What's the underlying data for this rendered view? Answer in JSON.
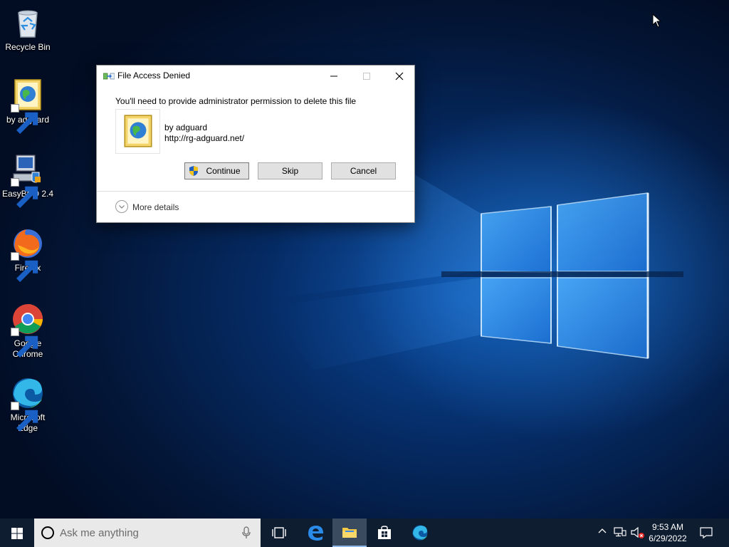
{
  "desktop": {
    "icons": [
      {
        "label": "Recycle Bin",
        "icon": "recycle-bin-icon"
      },
      {
        "label": "by adguard",
        "icon": "adguard-file-icon"
      },
      {
        "label": "EasyBCD 2.4",
        "icon": "easybcd-icon"
      },
      {
        "label": "Firefox",
        "icon": "firefox-icon"
      },
      {
        "label": "Google Chrome",
        "icon": "chrome-icon"
      },
      {
        "label": "Microsoft Edge",
        "icon": "edge-icon"
      }
    ]
  },
  "dialog": {
    "title": "File Access Denied",
    "message": "You'll need to provide administrator permission to delete this file",
    "file_name": "by adguard",
    "file_url": "http://rg-adguard.net/",
    "buttons": {
      "continue": "Continue",
      "skip": "Skip",
      "cancel": "Cancel"
    },
    "more_details": "More details"
  },
  "taskbar": {
    "search_placeholder": "Ask me anything",
    "apps": [
      "task-view",
      "edge-legacy",
      "file-explorer",
      "microsoft-store",
      "microsoft-edge"
    ],
    "clock": {
      "time": "9:53 AM",
      "date": "6/29/2022"
    }
  },
  "colors": {
    "taskbar": "#0f1d31",
    "wallpaper_accent": "#1a78e0",
    "button_face": "#e1e1e1"
  }
}
